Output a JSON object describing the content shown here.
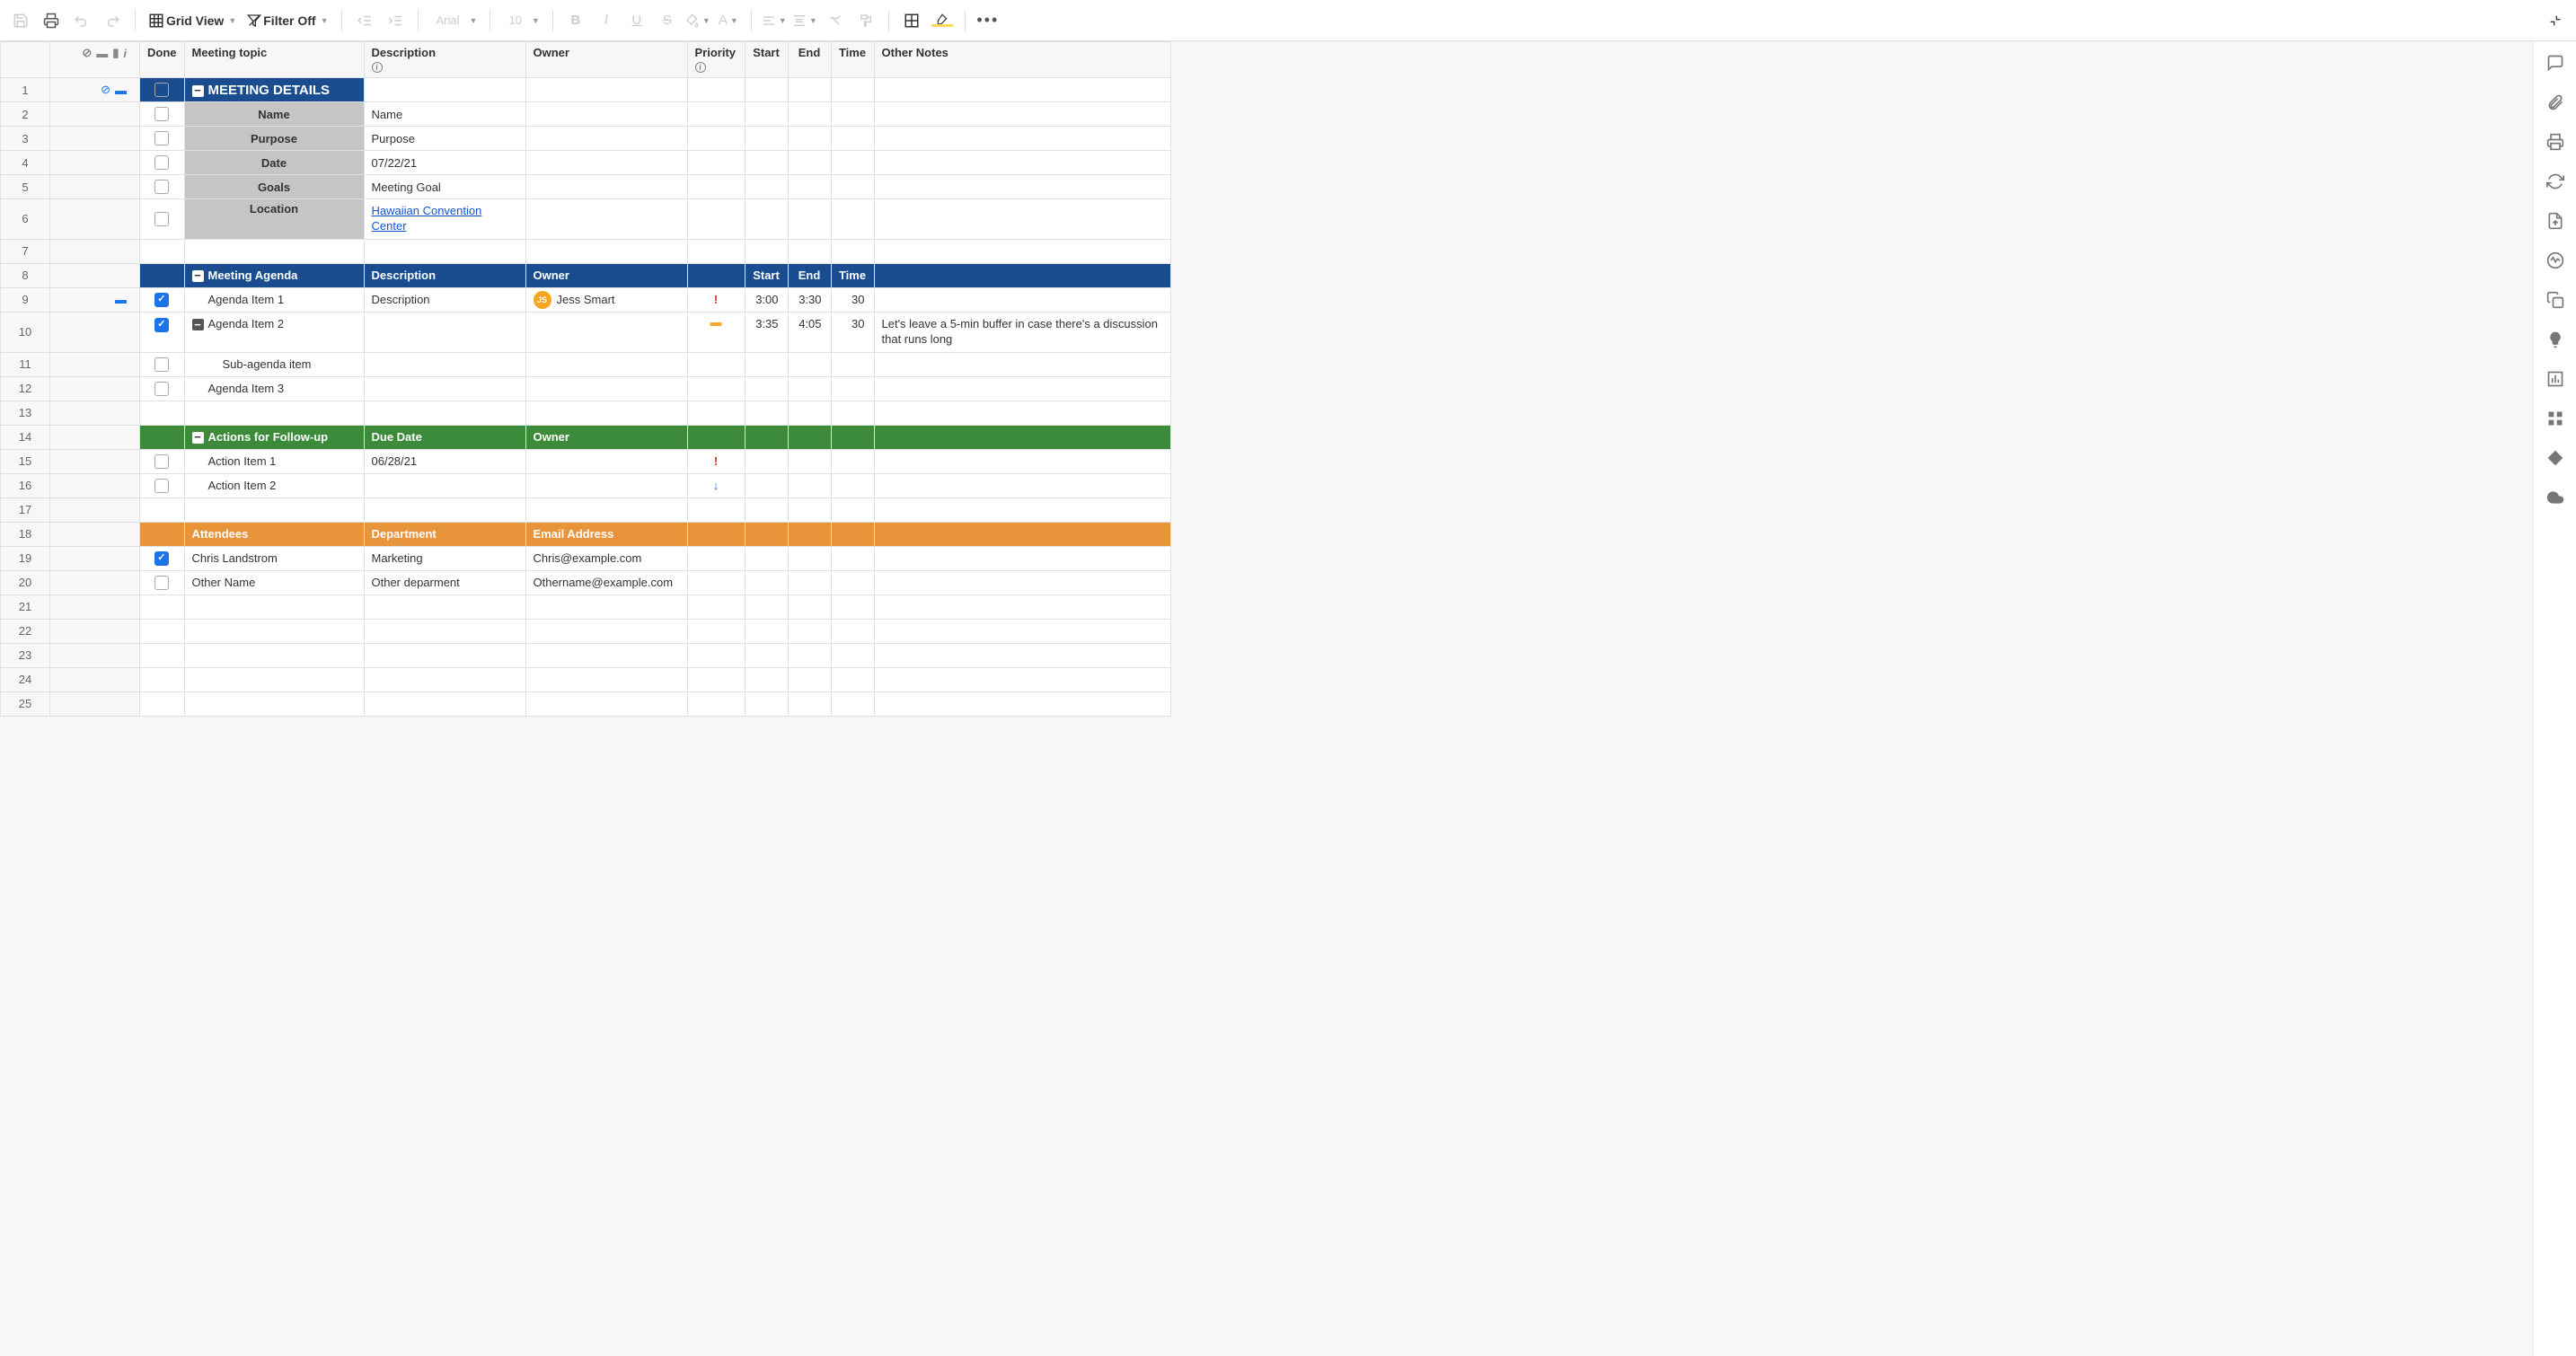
{
  "toolbar": {
    "view_label": "Grid View",
    "filter_label": "Filter Off",
    "font": "Arial",
    "size": "10"
  },
  "columns": {
    "done": "Done",
    "topic": "Meeting topic",
    "desc": "Description",
    "owner": "Owner",
    "priority": "Priority",
    "start": "Start",
    "end": "End",
    "time": "Time",
    "notes": "Other Notes"
  },
  "sections": {
    "meeting_details": "MEETING DETAILS",
    "agenda": "Meeting Agenda",
    "actions": "Actions for Follow-up",
    "attendees": "Attendees"
  },
  "details": {
    "name_label": "Name",
    "name_val": "Name",
    "purpose_label": "Purpose",
    "purpose_val": "Purpose",
    "date_label": "Date",
    "date_val": "07/22/21",
    "goals_label": "Goals",
    "goals_val": "Meeting Goal",
    "location_label": "Location",
    "location_val": "Hawaiian Convention Center"
  },
  "agenda_headers": {
    "desc": "Description",
    "owner": "Owner",
    "start": "Start",
    "end": "End",
    "time": "Time"
  },
  "agenda": [
    {
      "topic": "Agenda Item 1",
      "desc": "Description",
      "owner_initials": "JS",
      "owner": "Jess Smart",
      "priority": "high",
      "start": "3:00",
      "end": "3:30",
      "time": "30",
      "notes": ""
    },
    {
      "topic": "Agenda Item 2",
      "desc": "",
      "owner": "",
      "priority": "med",
      "start": "3:35",
      "end": "4:05",
      "time": "30",
      "notes": "Let's leave a 5-min buffer in case there's a discussion that runs long"
    },
    {
      "topic": "Sub-agenda item"
    },
    {
      "topic": "Agenda Item 3"
    }
  ],
  "actions_headers": {
    "due": "Due Date",
    "owner": "Owner"
  },
  "actions": [
    {
      "topic": "Action Item 1",
      "due": "06/28/21",
      "priority": "high"
    },
    {
      "topic": "Action Item 2",
      "due": "",
      "priority": "low"
    }
  ],
  "attendees_headers": {
    "dept": "Department",
    "email": "Email Address"
  },
  "attendees_section_label": "Attendees",
  "attendees": [
    {
      "name": "Chris Landstrom",
      "dept": "Marketing",
      "email": "Chris@example.com",
      "done": true
    },
    {
      "name": "Other Name",
      "dept": "Other deparment",
      "email": "Othername@example.com",
      "done": false
    }
  ],
  "row_numbers": [
    "1",
    "2",
    "3",
    "4",
    "5",
    "6",
    "7",
    "8",
    "9",
    "10",
    "11",
    "12",
    "13",
    "14",
    "15",
    "16",
    "17",
    "18",
    "19",
    "20",
    "21",
    "22",
    "23",
    "24",
    "25"
  ]
}
